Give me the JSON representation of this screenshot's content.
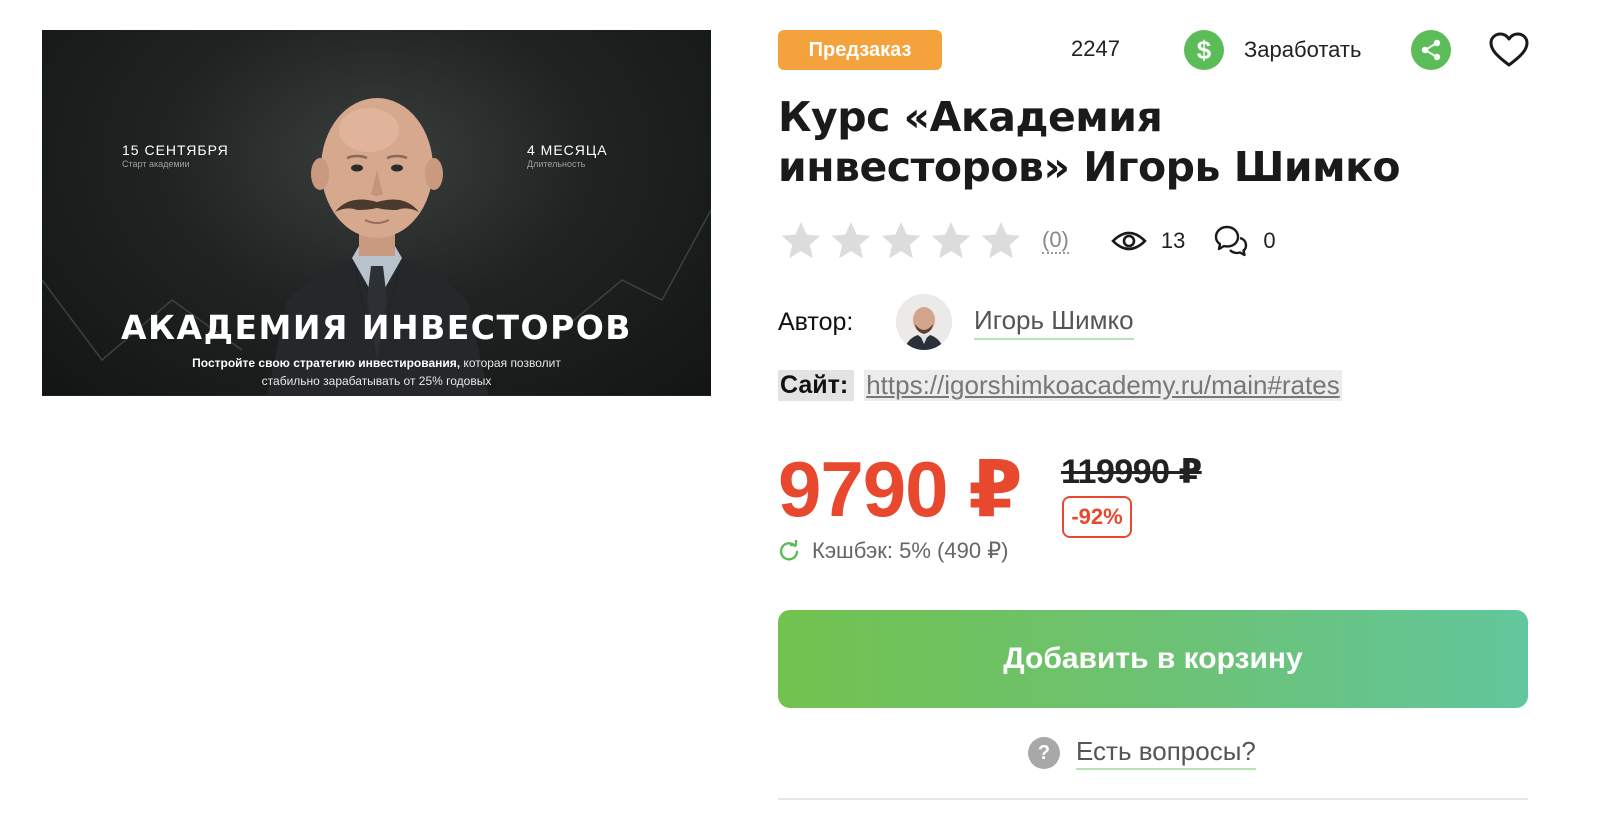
{
  "banner": {
    "date_big": "15 СЕНТЯБРЯ",
    "date_small": "Старт академии",
    "duration_big": "4 МЕСЯЦА",
    "duration_small": "Длительность",
    "headline": "АКАДЕМИЯ ИНВЕСТОРОВ",
    "sub_bold": "Постройте свою стратегию инвестирования,",
    "sub_rest": " которая позволит",
    "sub_line2": "стабильно зарабатывать от 25% годовых"
  },
  "header": {
    "badge": "Предзаказ",
    "counter": "2247",
    "earn_symbol": "$",
    "earn_label": "Заработать"
  },
  "product": {
    "title_line1": "Курс «Академия",
    "title_line2": "инвесторов» Игорь Шимко",
    "rating_count": "(0)",
    "views": "13",
    "comments": "0",
    "author_label": "Автор:",
    "author_name": "Игорь Шимко",
    "site_label": "Сайт:",
    "site_url": "https://igorshimkoacademy.ru/main#rates",
    "price": "9790 ₽",
    "old_price": "119990 ₽",
    "discount": "-92%",
    "cashback": "Кэшбэк: 5% (490 ₽)",
    "cart_button": "Добавить в корзину",
    "questions": "Есть вопросы?",
    "questions_icon": "?"
  },
  "colors": {
    "accent_green": "#5cbc58",
    "price_red": "#e8492e",
    "badge_orange": "#f4a33c"
  }
}
